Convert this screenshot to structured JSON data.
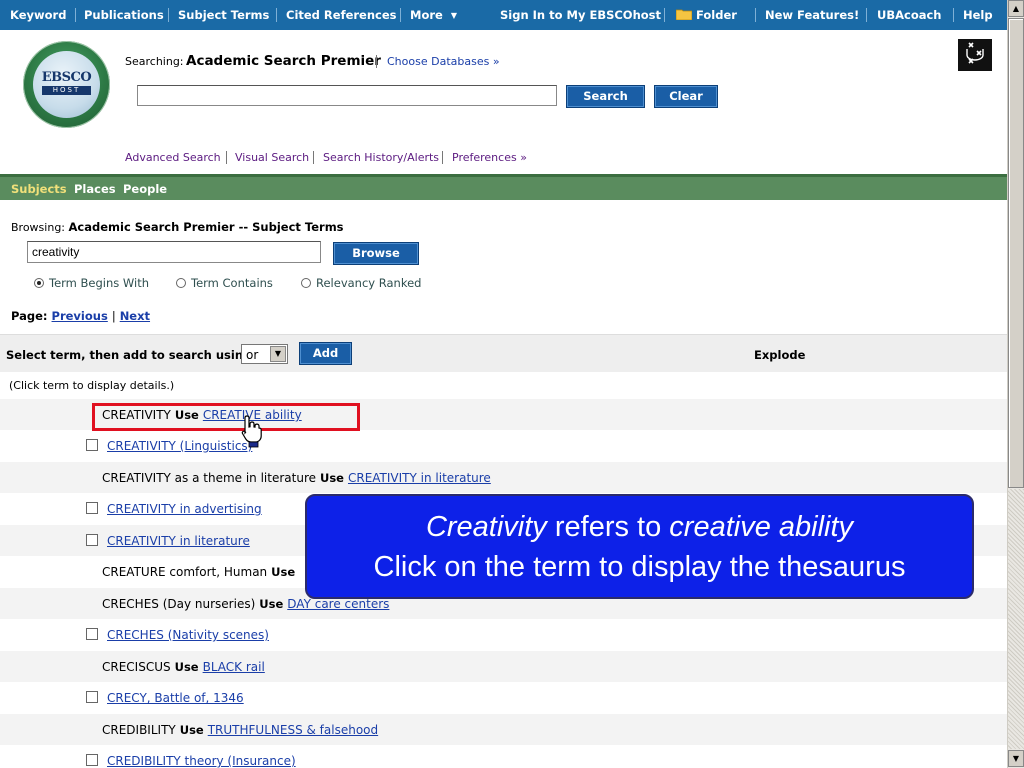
{
  "topnav": {
    "items": [
      "Keyword",
      "Publications",
      "Subject Terms",
      "Cited References",
      "More",
      "Sign In to My EBSCOhost",
      "Folder",
      "New Features!",
      "UBAcoach",
      "Help"
    ]
  },
  "header": {
    "logo_text": "EBSCO",
    "logo_sub": "HOST",
    "searching_label": "Searching:",
    "database": "Academic Search Premier",
    "choose_databases": "Choose Databases »",
    "search_value": "",
    "search_button": "Search",
    "clear_button": "Clear",
    "uva_logo": "UvA",
    "links": [
      "Advanced Search",
      "Visual Search",
      "Search History/Alerts",
      "Preferences »"
    ]
  },
  "tabs": [
    "Subjects",
    "Places",
    "People"
  ],
  "browse": {
    "label": "Browsing:",
    "title": "Academic Search Premier -- Subject Terms",
    "input_value": "creativity",
    "button": "Browse",
    "radios": [
      {
        "label": "Term Begins With",
        "checked": true
      },
      {
        "label": "Term Contains",
        "checked": false
      },
      {
        "label": "Relevancy Ranked",
        "checked": false
      }
    ],
    "page_label": "Page:",
    "previous": "Previous",
    "next": "Next"
  },
  "select_bar": {
    "label": "Select term, then add to search using:",
    "operator": "or",
    "add_button": "Add",
    "explode": "Explode"
  },
  "hint": "(Click term to display details.)",
  "terms": [
    {
      "term": "CREATIVITY",
      "use": "Use",
      "link": "CREATIVE ability"
    },
    {
      "link": "CREATIVITY (Linguistics)"
    },
    {
      "term": "CREATIVITY as a theme in literature",
      "use": "Use",
      "link": "CREATIVITY in literature"
    },
    {
      "link": "CREATIVITY in advertising"
    },
    {
      "link": "CREATIVITY in literature"
    },
    {
      "term": "CREATURE comfort, Human",
      "use": "Use"
    },
    {
      "term": "CRECHES (Day nurseries)",
      "use": "Use",
      "link": "DAY care centers"
    },
    {
      "link": "CRECHES (Nativity scenes)"
    },
    {
      "term": "CRECISCUS",
      "use": "Use",
      "link": "BLACK rail"
    },
    {
      "link": "CRECY, Battle of, 1346"
    },
    {
      "term": "CREDIBILITY",
      "use": "Use",
      "link": "TRUTHFULNESS & falsehood"
    },
    {
      "link": "CREDIBILITY theory (Insurance)"
    }
  ],
  "callout": {
    "line1_italic_a": "Creativity",
    "line1_mid": " refers to ",
    "line1_italic_b": "creative ability",
    "line2": "Click on the term to display the thesaurus"
  },
  "colors": {
    "nav_blue": "#1a6aa6",
    "green_bar": "#5a8c5e",
    "callout_blue": "#0d21e8",
    "highlight_red": "#e01020",
    "link_blue": "#1a3ea8"
  }
}
